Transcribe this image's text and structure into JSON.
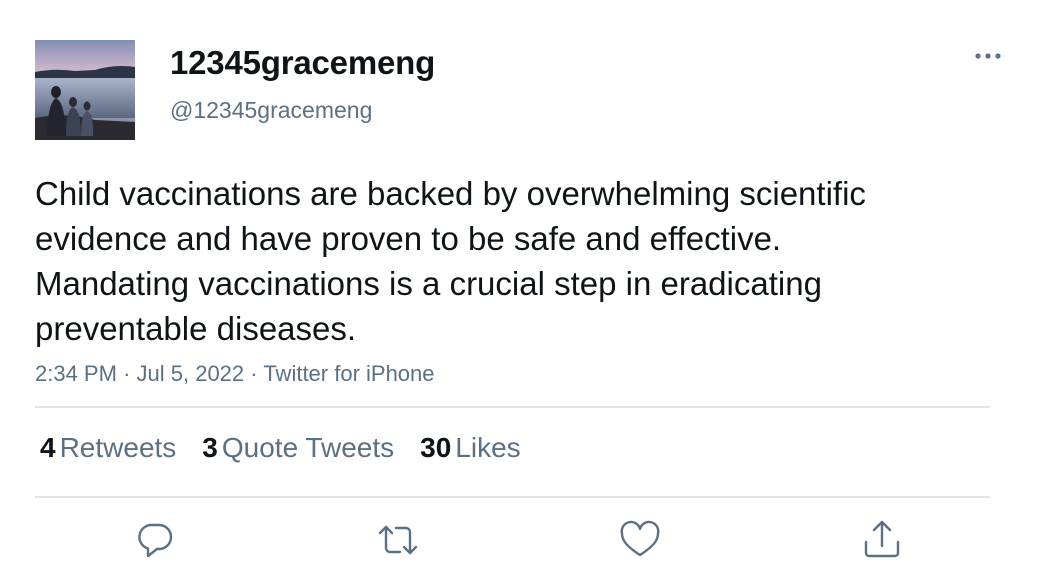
{
  "user": {
    "display_name": "12345gracemeng",
    "handle": "@12345gracemeng",
    "avatar": "profile-photo-lakeside"
  },
  "tweet": {
    "text": "Child vaccinations are backed by overwhelming scientific evidence and have proven to be safe and effective. Mandating vaccinations is a crucial step in eradicating preventable diseases.",
    "time": "2:34 PM",
    "separator": "·",
    "date": "Jul 5, 2022",
    "source": "Twitter for iPhone"
  },
  "stats": {
    "retweets_count": "4",
    "retweets_label": "Retweets",
    "quotes_count": "3",
    "quotes_label": "Quote Tweets",
    "likes_count": "30",
    "likes_label": "Likes"
  },
  "actions": {
    "icons": [
      "reply-icon",
      "retweet-icon",
      "like-icon",
      "share-icon"
    ]
  },
  "colors": {
    "primary_text": "#0f1419",
    "secondary_text": "#5b7083",
    "divider": "#e1e4e8",
    "icon": "#5b7083"
  }
}
